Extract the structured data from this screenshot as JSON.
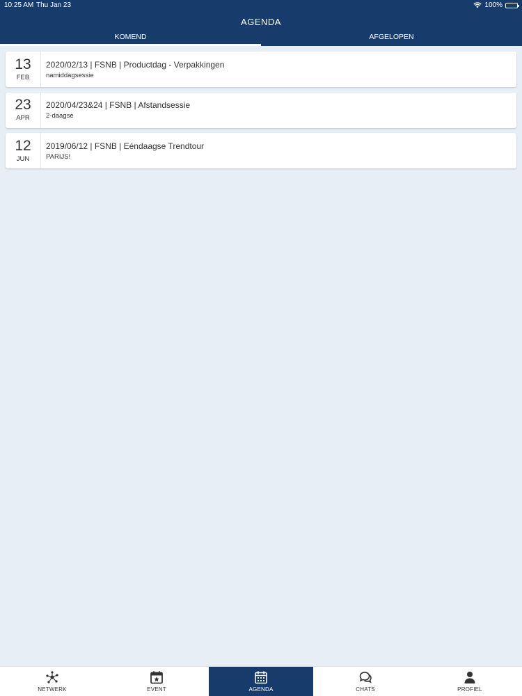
{
  "status_bar": {
    "time": "10:25 AM",
    "date": "Thu Jan 23",
    "battery": "100%"
  },
  "header": {
    "title": "AGENDA",
    "tabs": [
      {
        "label": "KOMEND",
        "active": true
      },
      {
        "label": "AFGELOPEN",
        "active": false
      }
    ]
  },
  "events": [
    {
      "day": "13",
      "month": "FEB",
      "title": "2020/02/13 | FSNB | Productdag - Verpakkingen",
      "subtitle": "namiddagsessie"
    },
    {
      "day": "23",
      "month": "APR",
      "title": "2020/04/23&24 | FSNB | Afstandsessie",
      "subtitle": "2-daagse"
    },
    {
      "day": "12",
      "month": "JUN",
      "title": "2019/06/12 | FSNB | Eéndaagse Trendtour",
      "subtitle": "PARIJS!"
    }
  ],
  "tabbar": {
    "items": [
      {
        "label": "NETWERK",
        "icon": "network-icon",
        "active": false
      },
      {
        "label": "EVENT",
        "icon": "calendar-star-icon",
        "active": false
      },
      {
        "label": "AGENDA",
        "icon": "calendar-grid-icon",
        "active": true
      },
      {
        "label": "CHATS",
        "icon": "chat-bubbles-icon",
        "active": false
      },
      {
        "label": "PROFIEL",
        "icon": "person-icon",
        "active": false
      }
    ]
  },
  "colors": {
    "primary": "#173c6c",
    "background": "#e8eef5",
    "card": "#ffffff"
  }
}
